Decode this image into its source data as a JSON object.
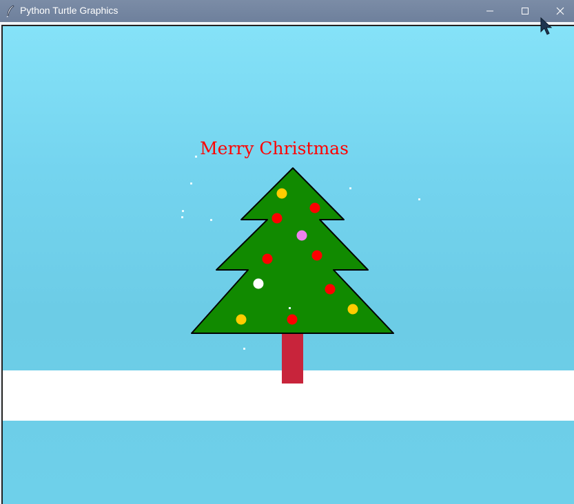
{
  "window": {
    "title": "Python Turtle Graphics",
    "buttons": [
      "minimize-icon",
      "maximize-icon",
      "close-icon"
    ]
  },
  "canvas": {
    "greeting": "Merry Christmas",
    "colors": {
      "sky": "#74d4ef",
      "snow_ground": "#ffffff",
      "tree_fill": "#118a00",
      "tree_outline": "#000000",
      "trunk": "#c8243b",
      "greeting_text": "#ff0000"
    },
    "ornaments": [
      {
        "color": "#ffcc00"
      },
      {
        "color": "#ff0000"
      },
      {
        "color": "#ff0000"
      },
      {
        "color": "#ee82ee"
      },
      {
        "color": "#ff0000"
      },
      {
        "color": "#ff0000"
      },
      {
        "color": "#ffffff"
      },
      {
        "color": "#ff0000"
      },
      {
        "color": "#ffcc00"
      },
      {
        "color": "#ffcc00"
      },
      {
        "color": "#ff0000"
      }
    ]
  }
}
